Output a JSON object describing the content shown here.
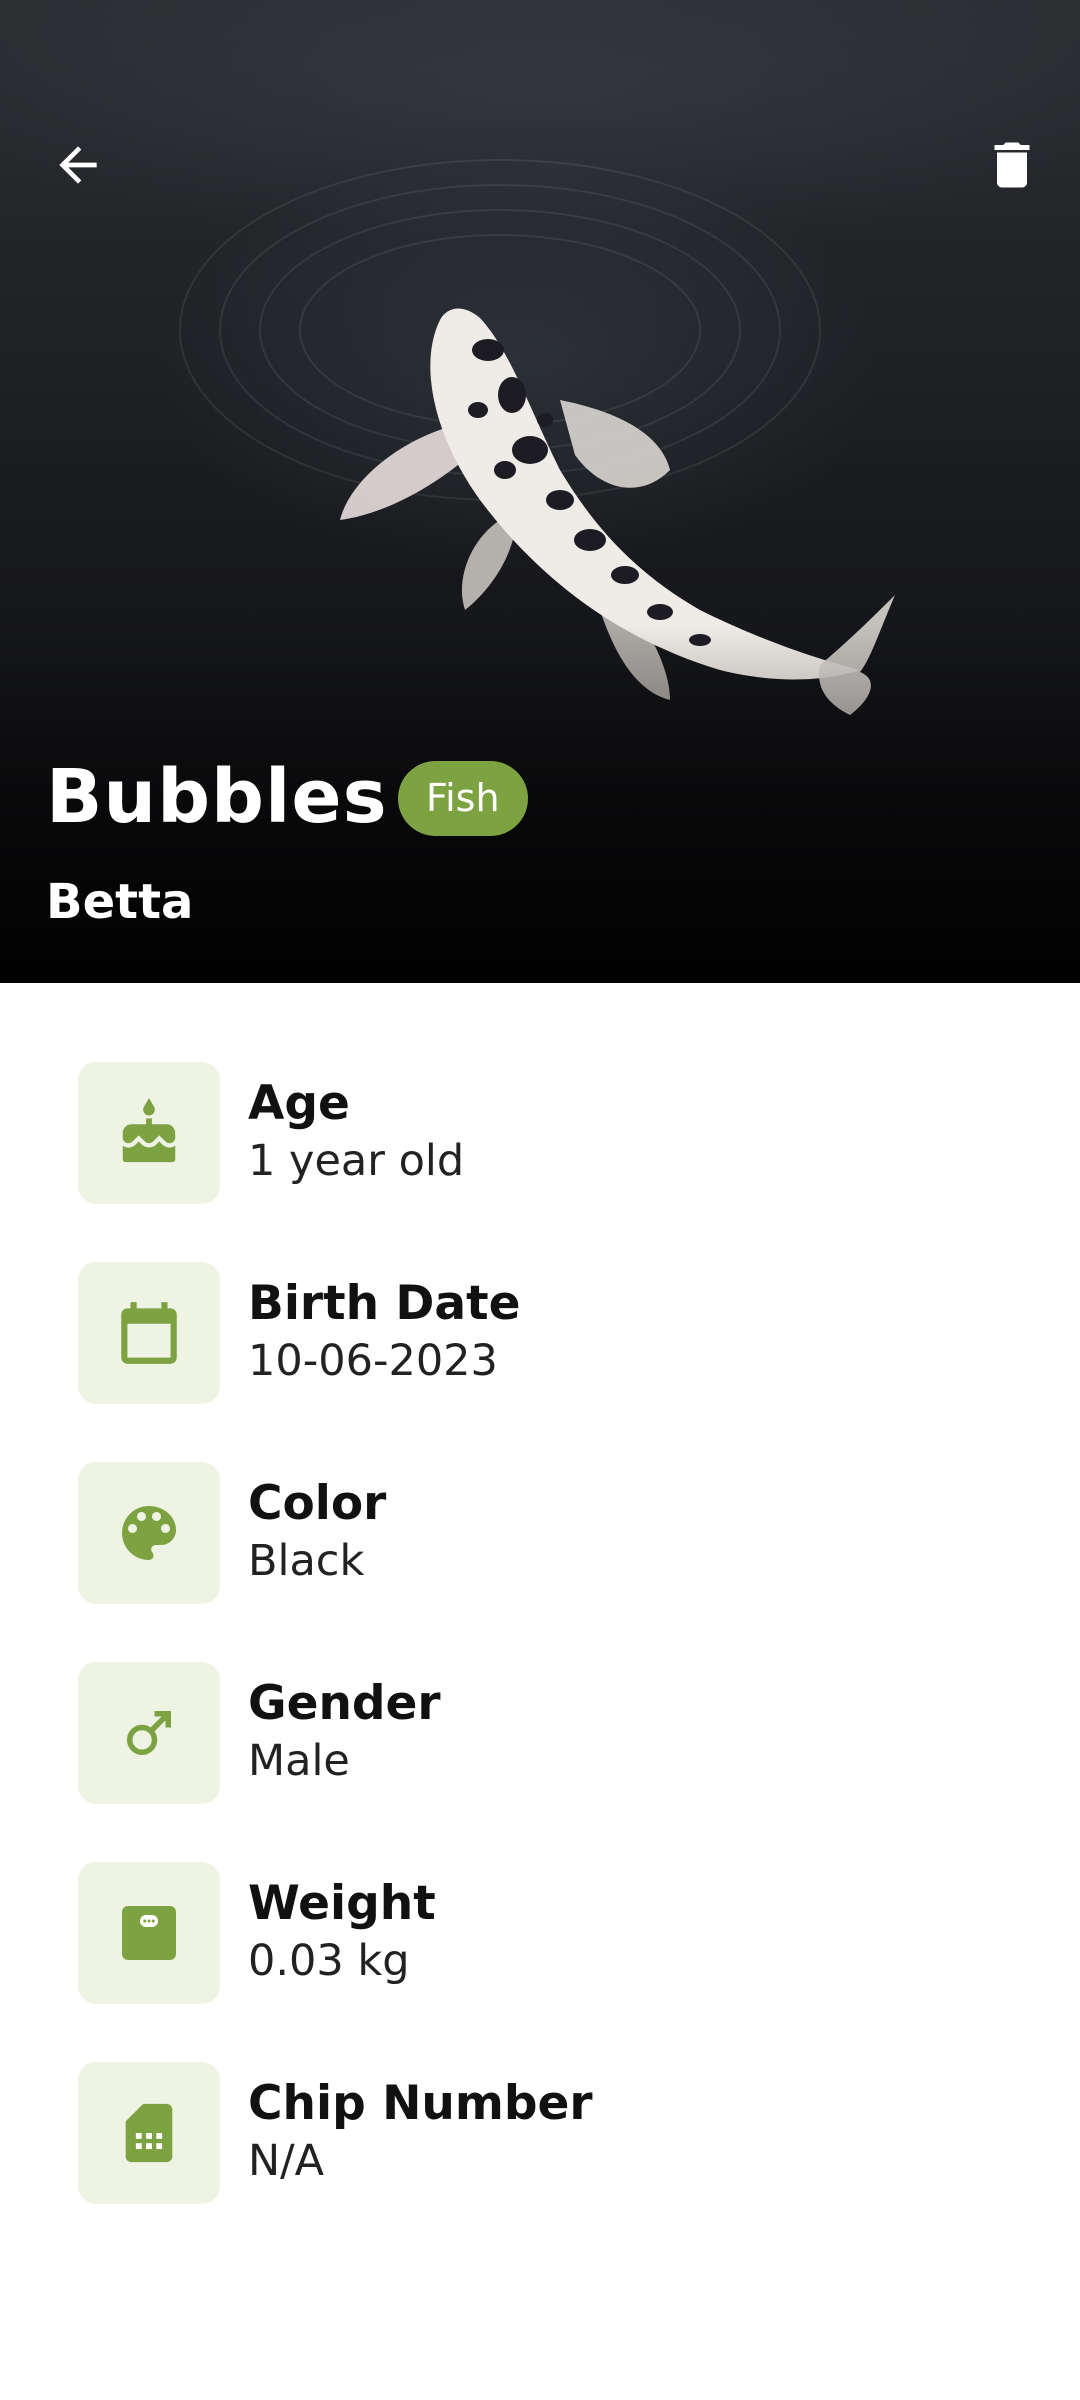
{
  "header": {
    "back_icon": "arrow-back-icon",
    "delete_icon": "trash-icon"
  },
  "pet": {
    "name": "Bubbles",
    "species": "Fish",
    "breed": "Betta"
  },
  "details": [
    {
      "icon": "cake-icon",
      "label": "Age",
      "value": "1 year old"
    },
    {
      "icon": "calendar-icon",
      "label": "Birth Date",
      "value": "10-06-2023"
    },
    {
      "icon": "palette-icon",
      "label": "Color",
      "value": "Black"
    },
    {
      "icon": "male-icon",
      "label": "Gender",
      "value": "Male"
    },
    {
      "icon": "scale-icon",
      "label": "Weight",
      "value": "0.03 kg"
    },
    {
      "icon": "sim-card-icon",
      "label": "Chip Number",
      "value": "N/A"
    }
  ],
  "colors": {
    "accent": "#7da242",
    "icon_tile_bg": "#eef3e3",
    "text_primary": "#111111"
  }
}
